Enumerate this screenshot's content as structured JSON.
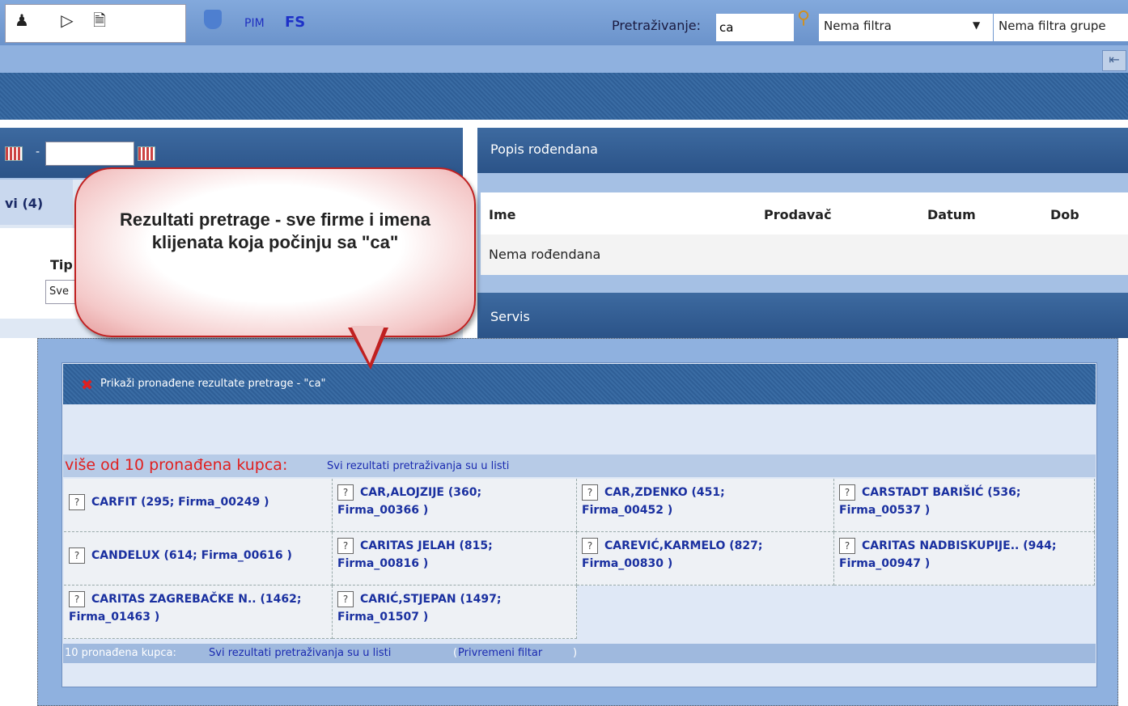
{
  "toolbar": {
    "pim_label": "PIM",
    "fs_label": "FS",
    "search_label": "Pretraživanje:",
    "search_value": "ca",
    "filter_value": "Nema filtra",
    "group_filter_value": "Nema filtra grupe",
    "icons": [
      "user-icon",
      "play-icon",
      "documents-icon",
      "pim-icon",
      "magnifier-icon",
      "collapse-icon"
    ]
  },
  "left_panel": {
    "tab_label": "vi (4)",
    "type_label": "Tip",
    "type_select_value": "Sve"
  },
  "birthdays": {
    "title": "Popis rođendana",
    "columns": [
      "Ime",
      "Prodavač",
      "Datum",
      "Dob"
    ],
    "empty_text": "Nema rođendana"
  },
  "servis": {
    "title": "Servis"
  },
  "callout": {
    "text": "Rezultati pretrage -  sve firme i imena klijenata koja počinju sa \"ca\""
  },
  "results": {
    "title": "Prikaži pronađene rezultate pretrage - \"ca\"",
    "summary_count": "više od 10 pronađena kupca:",
    "summary_link": "Svi rezultati pretraživanja su u listi",
    "q_icon": "?",
    "items": [
      {
        "line1": "CARFIT (295; Firma_00249 )",
        "line2": ""
      },
      {
        "line1": "CAR,ALOJZIJE (360;",
        "line2": "Firma_00366 )"
      },
      {
        "line1": "CAR,ZDENKO (451;",
        "line2": "Firma_00452 )"
      },
      {
        "line1": "CARSTADT BARIŠIĆ (536;",
        "line2": "Firma_00537 )"
      },
      {
        "line1": "CANDELUX (614; Firma_00616 )",
        "line2": ""
      },
      {
        "line1": "CARITAS JELAH (815;",
        "line2": "Firma_00816 )"
      },
      {
        "line1": "CAREVIĆ,KARMELO (827;",
        "line2": "Firma_00830 )"
      },
      {
        "line1": "CARITAS NADBISKUPIJE.. (944;",
        "line2": "Firma_00947 )"
      },
      {
        "line1": "CARITAS ZAGREBAČKE N.. (1462;",
        "line2": "Firma_01463 )"
      },
      {
        "line1": "CARIĆ,STJEPAN (1497;",
        "line2": "Firma_01507 )"
      }
    ],
    "footer_count": "10 pronađena kupca:",
    "footer_link": "Svi rezultati pretraživanja su u listi",
    "footer_paren_open": "(",
    "footer_filter_link": "Privremeni filtar",
    "footer_paren_close": ")"
  },
  "colors": {
    "toolbar": "#6f98cf",
    "header_dark": "#2f5f97",
    "accent_red": "#e02020",
    "link_blue": "#1a2ab0"
  }
}
